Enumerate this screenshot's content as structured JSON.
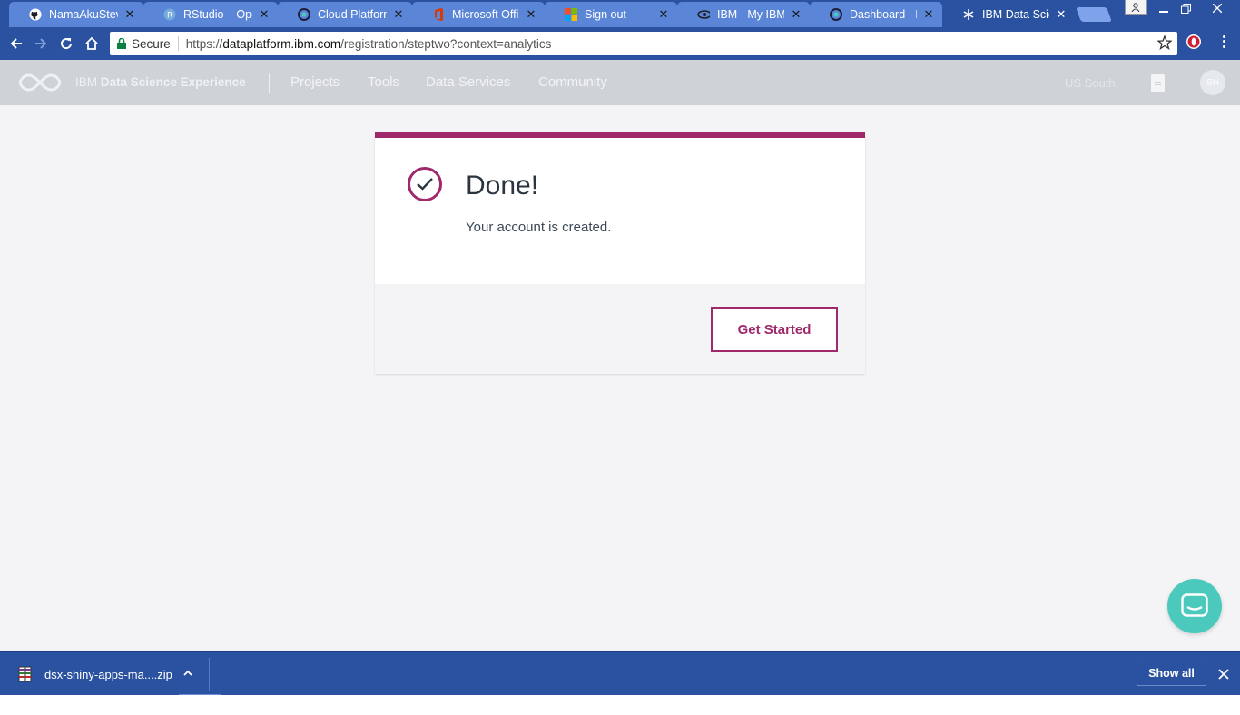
{
  "browser": {
    "tabs": [
      {
        "title": "NamaAkuSteven",
        "icon": "github-icon",
        "active": false
      },
      {
        "title": "RStudio – Open",
        "icon": "rstudio-icon",
        "active": false
      },
      {
        "title": "Cloud Platform",
        "icon": "cloud-icon",
        "active": false
      },
      {
        "title": "Microsoft Office",
        "icon": "office-icon",
        "active": false
      },
      {
        "title": "Sign out",
        "icon": "microsoft-icon",
        "active": false
      },
      {
        "title": "IBM - My IBM",
        "icon": "ibm-icon",
        "active": false
      },
      {
        "title": "Dashboard - IBM",
        "icon": "cloud-icon",
        "active": false
      },
      {
        "title": "IBM Data Science",
        "icon": "dsx-icon",
        "active": true
      }
    ],
    "security_label": "Secure",
    "url_scheme": "https://",
    "url_host": "dataplatform.ibm.com",
    "url_path": "/registration/steptwo?context=analytics"
  },
  "header": {
    "brand_prefix": "IBM",
    "brand_name": "Data Science Experience",
    "nav": [
      "Projects",
      "Tools",
      "Data Services",
      "Community"
    ],
    "region": "US South",
    "avatar_initials": "SH"
  },
  "card": {
    "title": "Done!",
    "message": "Your account is created.",
    "button_label": "Get Started",
    "accent_color": "#a0296b"
  },
  "downloads": {
    "file_name": "dsx-shiny-apps-ma....zip",
    "show_all_label": "Show all"
  }
}
